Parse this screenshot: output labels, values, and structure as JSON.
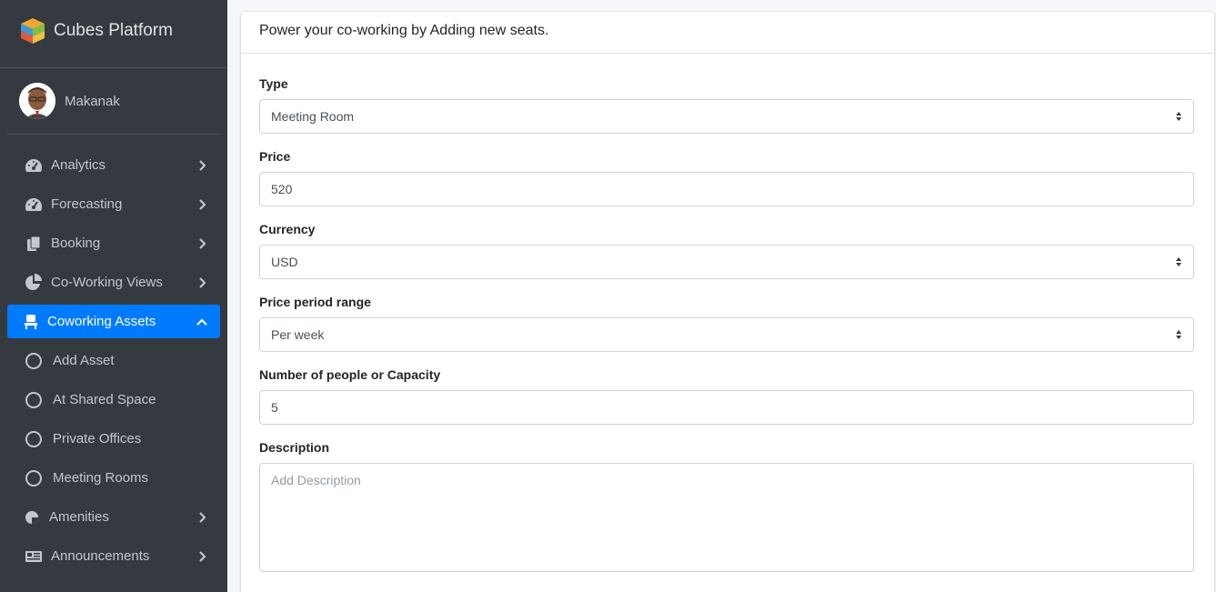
{
  "brand": {
    "title": "Cubes Platform",
    "logo_icon": "cube-logo-icon"
  },
  "user": {
    "name": "Makanak"
  },
  "nav": {
    "items": [
      {
        "label": "Analytics",
        "icon": "dashboard-gauge-icon"
      },
      {
        "label": "Forecasting",
        "icon": "dashboard-gauge-icon"
      },
      {
        "label": "Booking",
        "icon": "copy-icon"
      },
      {
        "label": "Co-Working Views",
        "icon": "pie-chart-icon"
      },
      {
        "label": "Coworking Assets",
        "icon": "chair-icon",
        "active": true
      },
      {
        "label": "Add Asset",
        "icon": "circle-icon"
      },
      {
        "label": "At Shared Space",
        "icon": "circle-icon"
      },
      {
        "label": "Private Offices",
        "icon": "circle-icon"
      },
      {
        "label": "Meeting Rooms",
        "icon": "circle-icon"
      },
      {
        "label": "Amenities",
        "icon": "amenities-icon"
      },
      {
        "label": "Announcements",
        "icon": "newspaper-icon"
      }
    ]
  },
  "colors": {
    "sidebar_bg": "#343a40",
    "active_bg": "#007bff",
    "page_bg": "#f4f6f9"
  },
  "card": {
    "header": "Power your co-working by Adding new seats."
  },
  "form": {
    "type": {
      "label": "Type",
      "value": "Meeting Room"
    },
    "price": {
      "label": "Price",
      "value": "520"
    },
    "currency": {
      "label": "Currency",
      "value": "USD"
    },
    "period": {
      "label": "Price period range",
      "value": "Per week"
    },
    "capacity": {
      "label": "Number of people or Capacity",
      "value": "5"
    },
    "description": {
      "label": "Description",
      "placeholder": "Add Description"
    }
  }
}
